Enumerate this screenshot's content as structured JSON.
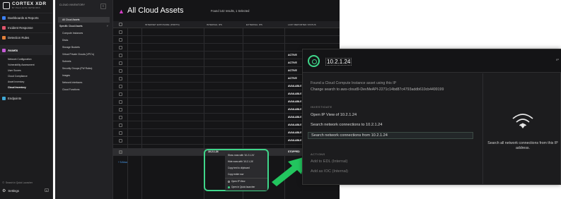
{
  "brand": {
    "name": "CORTEX XDR",
    "sub": "BY PALO ALTO NETWORKS"
  },
  "sidebar": {
    "items": [
      {
        "label": "Dashboards & Reports",
        "icon": "dashboard-icon",
        "color": "#3b82f6"
      },
      {
        "label": "Incident Response",
        "icon": "incident-icon",
        "color": "#e0556d"
      },
      {
        "label": "Detection Rules",
        "icon": "detection-icon",
        "color": "#e3813a"
      },
      {
        "label": "Assets",
        "icon": "assets-icon",
        "color": "#c65bd6"
      },
      {
        "label": "Endpoints",
        "icon": "endpoints-icon",
        "color": "#3fa8d6"
      }
    ],
    "asset_subitems": [
      "Network Configuration",
      "Vulnerability Assessment",
      "User Scores",
      "Cloud Compliance",
      "Asset Inventory",
      "Cloud Inventory"
    ],
    "search_label": "Search in Quick Launcher",
    "settings_label": "Settings"
  },
  "inventory": {
    "header": "CLOUD INVENTORY",
    "all_label": "All Cloud Assets",
    "group_label": "Specific Cloud Assets",
    "items": [
      "Compute Instances",
      "Disks",
      "Storage Buckets",
      "Virtual Private Clouds (VPC's)",
      "Subnets",
      "Security Groups (FW Rules)",
      "Images",
      "Network Interfaces",
      "Cloud Functions"
    ]
  },
  "main": {
    "title": "All Cloud Assets",
    "meta": "Found 142 results, 1 Selected",
    "columns": [
      "INTERNET EXPOSURE (PORTS)",
      "INTERNAL IPS",
      "EXTERNAL IPS",
      "LAST REPORTED STATUS"
    ],
    "rows": [
      {
        "status": ""
      },
      {
        "status": ""
      },
      {
        "status": ""
      },
      {
        "status": "ACTIVE"
      },
      {
        "status": "ACTIVE"
      },
      {
        "status": "ACTIVE"
      },
      {
        "status": "ACTIVE"
      },
      {
        "status": "AVAILABLE"
      },
      {
        "status": "AVAILABLE"
      },
      {
        "status": "AVAILABLE"
      },
      {
        "status": "AVAILABLE"
      },
      {
        "status": "AVAILABLE"
      },
      {
        "status": "AVAILABLE"
      },
      {
        "status": "AVAILABLE"
      },
      {
        "status": "AVAILABLE"
      }
    ],
    "more_link": "+ 5 Ahoo",
    "selected_row": {
      "ip": "10.2.1.24",
      "status": "STOPPED"
    }
  },
  "context_menu": {
    "items": [
      "Show rows with '10.2.1.24'",
      "Hide rows with '10.2.1.24'",
      "Copy text to clipboard",
      "Copy entire row",
      "Open IP View",
      "Open in Quick launcher"
    ]
  },
  "popup": {
    "ip": "10.2.1.24",
    "ip_tag": "IP",
    "found_line1": "Found a Cloud Compute Instance asset using this IP",
    "found_line2": "Change search to aws-cloud9-DevMeAPI-2271c14bd87c4793addb610cb4499199",
    "investigate_label": "INVESTIGATE",
    "investigate_links": [
      "Open IP View of 10.2.1.24",
      "Search network connections to 10.2.1.24",
      "Search network connections from 10.2.1.24"
    ],
    "actions_label": "ACTIONS",
    "action_links": [
      "Add to EDL (Internal)",
      "Add as IOC (Internal)"
    ],
    "side_text": "Search all network connections from this IP address.",
    "accent": "#3fd68a"
  }
}
